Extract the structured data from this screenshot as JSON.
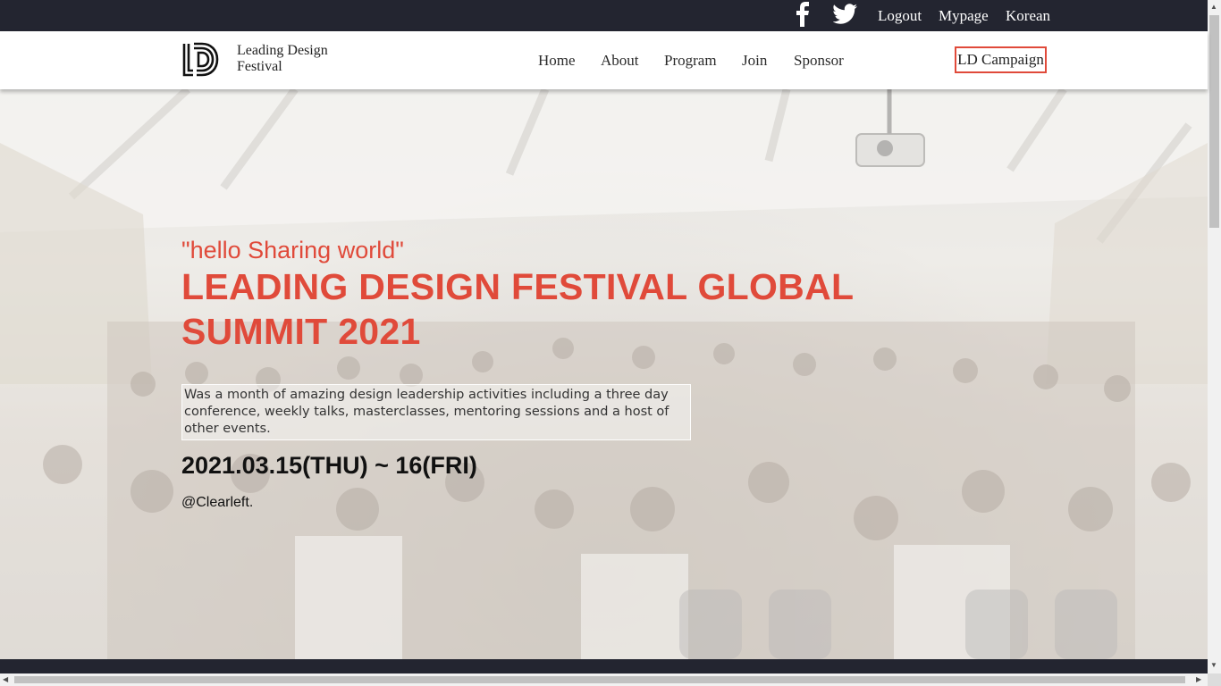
{
  "topbar": {
    "social": [
      "facebook-icon",
      "twitter-icon"
    ],
    "links": [
      "Logout",
      "Mypage",
      "Korean"
    ]
  },
  "header": {
    "brand": "Leading Design Festival",
    "nav": [
      "Home",
      "About",
      "Program",
      "Join",
      "Sponsor"
    ],
    "campaign": "LD Campaign"
  },
  "hero": {
    "tagline": "\"hello Sharing world\"",
    "headline": "LEADING DESIGN FESTIVAL GLOBAL SUMMIT 2021",
    "description": "Was a month of amazing design leadership activities including a three day conference, weekly talks, masterclasses, mentoring sessions and a host of other events.",
    "date": "2021.03.15(THU) ~ 16(FRI)",
    "organizer": "@Clearleft."
  },
  "colors": {
    "accent": "#e04a3a",
    "dark_bar": "#232530"
  }
}
